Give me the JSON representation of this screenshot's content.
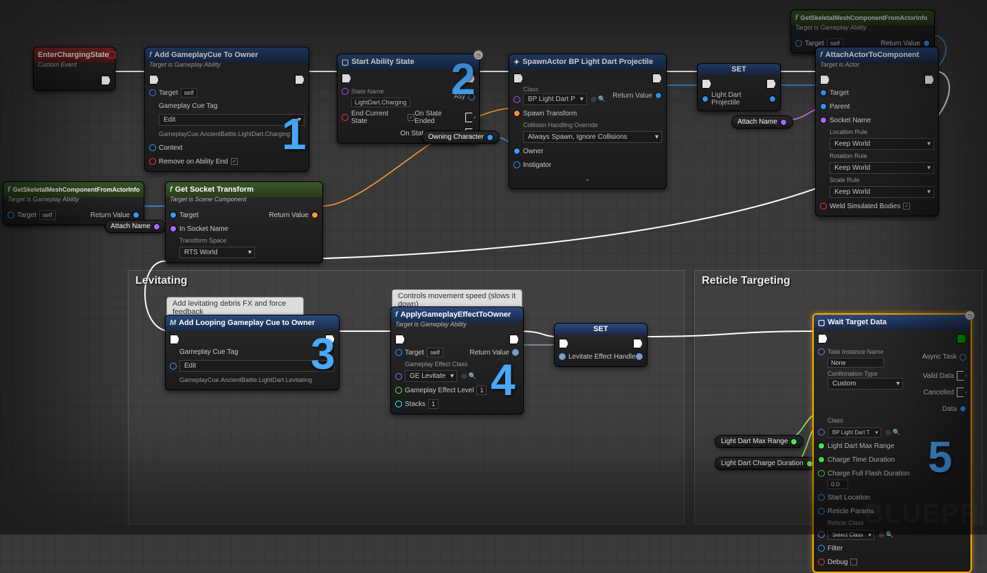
{
  "nodes": {
    "enterCharging": {
      "title": "EnterChargingState",
      "subtitle": "Custom Event"
    },
    "addCue": {
      "title": "Add GameplayCue To Owner",
      "subtitle": "Target is Gameplay Ability",
      "target": "Target",
      "self": "self",
      "tagLbl": "Gameplay Cue Tag",
      "tagDrop": "Edit",
      "tagPath": "GameplayCue.AncientBattle.LightDart.Charging",
      "context": "Context",
      "remove": "Remove on Ability End"
    },
    "startState": {
      "title": "Start Ability State",
      "stateNameLbl": "State Name",
      "stateName": "LightDart.Charging",
      "endCurrent": "End Current State",
      "async": "Asy",
      "onEnded": "On State Ended",
      "onInterrupted": "On State Interrupted"
    },
    "owningChar": {
      "label": "Owning Character"
    },
    "spawn": {
      "title": "SpawnActor BP Light Dart Projectile",
      "classLbl": "Class",
      "classVal": "BP Light Dart P",
      "spawnTransform": "Spawn Transform",
      "collisionLbl": "Collision Handling Override",
      "collisionVal": "Always Spawn, Ignore Collisions",
      "owner": "Owner",
      "instigator": "Instigator",
      "returnValue": "Return Value"
    },
    "set1": {
      "title": "SET",
      "var": "Light Dart Projectile"
    },
    "getSkel1": {
      "title": "GetSkeletalMeshComponentFromActorInfo",
      "subtitle": "Target is Gameplay Ability",
      "target": "Target",
      "self": "self",
      "returnValue": "Return Value"
    },
    "attach": {
      "title": "AttachActorToComponent",
      "subtitle": "Target is Actor",
      "target": "Target",
      "parent": "Parent",
      "socketName": "Socket Name",
      "locationRule": "Location Rule",
      "locVal": "Keep World",
      "rotationRule": "Rotation Rule",
      "rotVal": "Keep World",
      "scaleRule": "Scale Rule",
      "scaleVal": "Keep World",
      "weld": "Weld Simulated Bodies"
    },
    "attachName": {
      "label": "Attach Name"
    },
    "getSkel2": {
      "title": "GetSkeletalMeshComponentFromActorInfo",
      "subtitle": "Target is Gameplay Ability",
      "target": "Target",
      "self": "self",
      "returnValue": "Return Value"
    },
    "attachName2": {
      "label": "Attach Name"
    },
    "getSocket": {
      "title": "Get Socket Transform",
      "subtitle": "Target is Scene Component",
      "target": "Target",
      "inSocket": "In Socket Name",
      "space": "Transform Space",
      "spaceVal": "RTS World",
      "returnValue": "Return Value"
    },
    "levSection": "Levitating",
    "levBubble": "Add levitating debris FX and force feedback",
    "loopCue": {
      "title": "Add Looping Gameplay Cue to Owner",
      "tagLbl": "Gameplay Cue Tag",
      "tagDrop": "Edit",
      "tagPath": "GameplayCue.AncientBattle.LightDart.Levitating",
      "prefix": "M"
    },
    "ctrlBubble": "Controls movement speed (slows it down)",
    "applyGE": {
      "title": "ApplyGameplayEffectToOwner",
      "subtitle": "Target is Gameplay Ability",
      "target": "Target",
      "self": "self",
      "geClassLbl": "Gameplay Effect Class",
      "geClass": "GE Levitate",
      "geLevel": "Gameplay Effect Level",
      "geLevelVal": "1",
      "stacks": "Stacks",
      "stacksVal": "1",
      "returnValue": "Return Value"
    },
    "set2": {
      "title": "SET",
      "var": "Levitate Effect Handle"
    },
    "reticleSection": "Reticle Targeting",
    "waitTarget": {
      "title": "Wait Target Data",
      "taskName": "Task Instance Name",
      "taskVal": "None",
      "confType": "Confirmation Type",
      "confVal": "Custom",
      "classLbl": "Class",
      "classVal": "BP Light Dart T",
      "maxRange": "Light Dart Max Range",
      "chargeTime": "Charge Time Duration",
      "flashDur": "Charge Full Flash Duration",
      "flashVal": "0.0",
      "startLoc": "Start Location",
      "retParams": "Reticle Params",
      "retClassLbl": "Reticle Class",
      "retClassVal": "Select Class",
      "filter": "Filter",
      "debug": "Debug",
      "asyncTask": "Async Task",
      "validData": "Valid Data",
      "cancelled": "Cancelled",
      "data": "Data"
    },
    "maxRangeVar": {
      "label": "Light Dart Max Range"
    },
    "chargeDurVar": {
      "label": "Light Dart Charge Duration"
    }
  },
  "annotations": [
    "1",
    "2",
    "3",
    "4",
    "5"
  ],
  "watermark": "BLUEPR"
}
